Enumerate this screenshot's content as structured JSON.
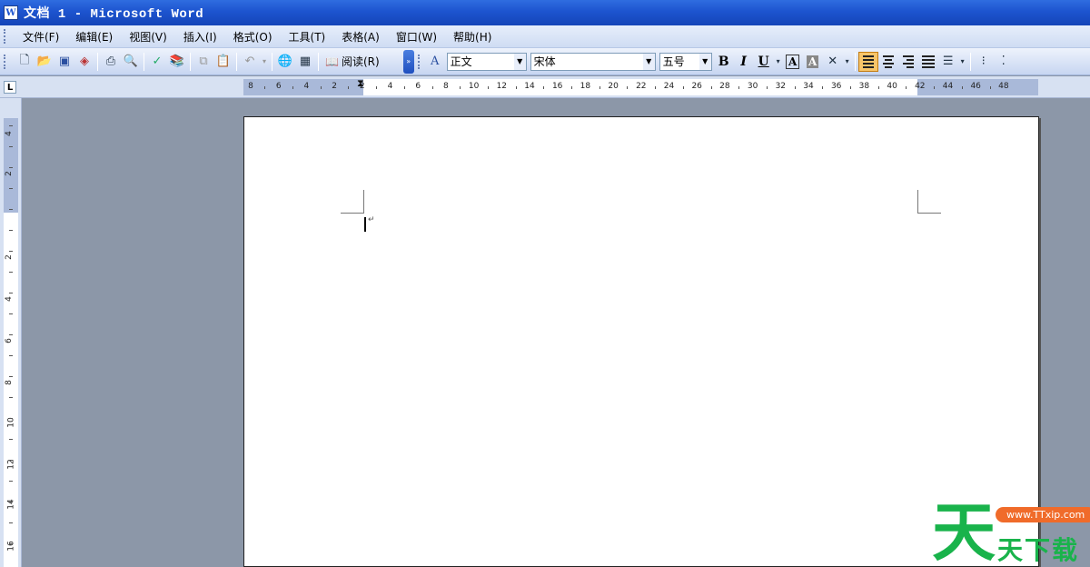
{
  "window": {
    "title": "文档 1 - Microsoft Word",
    "app_icon": "W"
  },
  "menu": [
    {
      "label": "文件(F)"
    },
    {
      "label": "编辑(E)"
    },
    {
      "label": "视图(V)"
    },
    {
      "label": "插入(I)"
    },
    {
      "label": "格式(O)"
    },
    {
      "label": "工具(T)"
    },
    {
      "label": "表格(A)"
    },
    {
      "label": "窗口(W)"
    },
    {
      "label": "帮助(H)"
    }
  ],
  "toolbar": {
    "read_label": "阅读(R)",
    "style_value": "正文",
    "font_value": "宋体",
    "size_value": "五号",
    "bold": "B",
    "italic": "I",
    "underline": "U",
    "boxed_char": "A",
    "shaded_char": "A"
  },
  "ruler": {
    "tab_selector": "L",
    "h_labels": [
      "8",
      "6",
      "4",
      "2",
      "2",
      "4",
      "6",
      "8",
      "10",
      "12",
      "14",
      "16",
      "18",
      "20",
      "22",
      "24",
      "26",
      "28",
      "30",
      "32",
      "34",
      "36",
      "38",
      "40",
      "42",
      "44",
      "46",
      "48"
    ],
    "v_labels": [
      "4",
      "2",
      "2",
      "4",
      "6",
      "8",
      "10",
      "12",
      "14",
      "16"
    ]
  },
  "document": {
    "paragraph_mark": "↵"
  },
  "watermark": {
    "big": "天",
    "pill": "www.TTxip.com",
    "small": "天下载"
  },
  "colors": {
    "title_bar": "#1d54cf",
    "workspace": "#8c97a8",
    "active_align": "#f7c56a"
  }
}
